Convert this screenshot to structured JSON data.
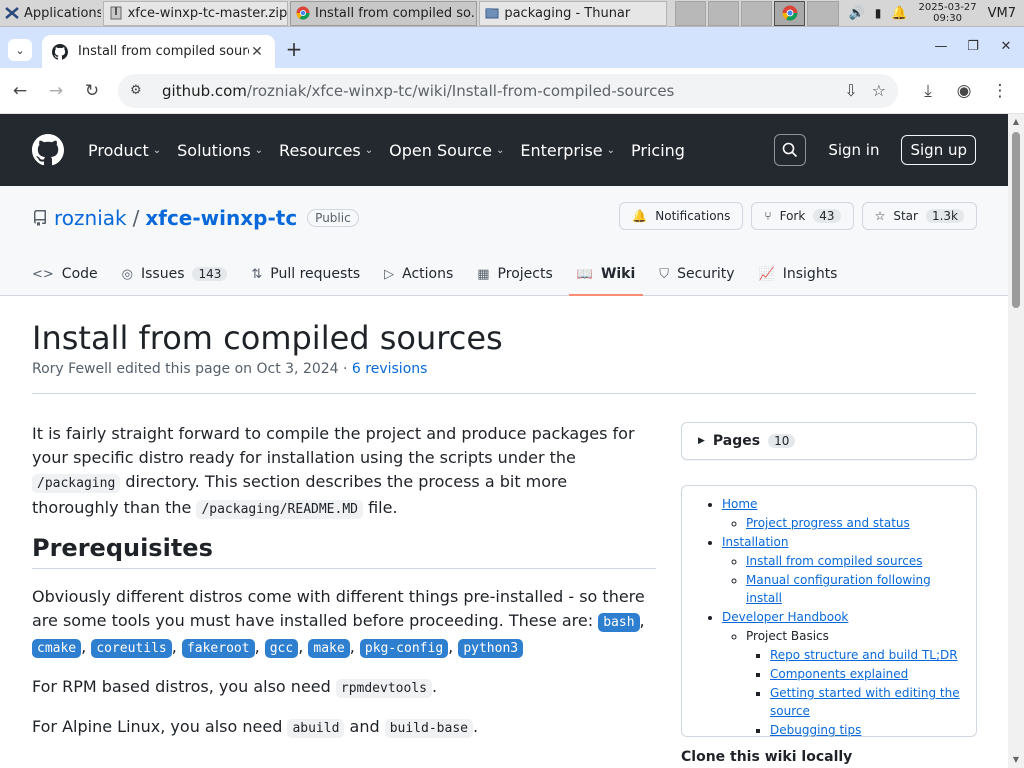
{
  "panel": {
    "applications_label": "Applications",
    "tasks": [
      {
        "label": "xfce-winxp-tc-master.zip ..."
      },
      {
        "label": "Install from compiled so..."
      },
      {
        "label": "packaging - Thunar"
      }
    ],
    "clock_date": "2025-03-27",
    "clock_time": "09:30",
    "vm_label": "VM7"
  },
  "browser": {
    "tab_title": "Install from compiled sourc",
    "url_host": "github.com",
    "url_path": "/rozniak/xfce-winxp-tc/wiki/Install-from-compiled-sources"
  },
  "github_nav": {
    "items": [
      "Product",
      "Solutions",
      "Resources",
      "Open Source",
      "Enterprise",
      "Pricing"
    ],
    "sign_in": "Sign in",
    "sign_up": "Sign up"
  },
  "repo": {
    "owner": "rozniak",
    "separator": "/",
    "name": "xfce-winxp-tc",
    "visibility": "Public",
    "notifications_label": "Notifications",
    "fork_label": "Fork",
    "fork_count": "43",
    "star_label": "Star",
    "star_count": "1.3k",
    "tabs": [
      {
        "label": "Code",
        "icon": "code-icon"
      },
      {
        "label": "Issues",
        "icon": "issue-icon",
        "count": "143"
      },
      {
        "label": "Pull requests",
        "icon": "pull-request-icon"
      },
      {
        "label": "Actions",
        "icon": "play-icon"
      },
      {
        "label": "Projects",
        "icon": "table-icon"
      },
      {
        "label": "Wiki",
        "icon": "book-icon",
        "selected": true
      },
      {
        "label": "Security",
        "icon": "shield-icon"
      },
      {
        "label": "Insights",
        "icon": "graph-icon"
      }
    ]
  },
  "page": {
    "title": "Install from compiled sources",
    "meta_text": "Rory Fewell edited this page on Oct 3, 2024 · ",
    "revisions_link": "6 revisions",
    "intro_1": "It is fairly straight forward to compile the project and produce packages for your specific distro ready for installation using the scripts under the ",
    "intro_code_1": "/packaging",
    "intro_2": " directory. This section describes the process a bit more thoroughly than the ",
    "intro_code_2": "/packaging/README.MD",
    "intro_3": " file.",
    "prereq_heading": "Prerequisites",
    "prereq_text": "Obviously different distros come with different things pre-installed - so there are some tools you must have installed before proceeding. These are: ",
    "prereq_tools": [
      "bash",
      "cmake",
      "coreutils",
      "fakeroot",
      "gcc",
      "make",
      "pkg-config",
      "python3"
    ],
    "rpm_text": "For RPM based distros, you also need ",
    "rpm_code": "rpmdevtools",
    "alpine_text": "For Alpine Linux, you also need ",
    "alpine_code_1": "abuild",
    "alpine_and": " and ",
    "alpine_code_2": "build-base",
    "period": "."
  },
  "sidebar": {
    "pages_label": "Pages",
    "pages_count": "10",
    "toc": {
      "home": "Home",
      "home_children": [
        "Project progress and status"
      ],
      "installation": "Installation",
      "installation_children": [
        "Install from compiled sources",
        "Manual configuration following install"
      ],
      "dev": "Developer Handbook",
      "project_basics": "Project Basics",
      "project_basics_children": [
        "Repo structure and build TL;DR",
        "Components explained",
        "Getting started with editing the source",
        "Debugging tips"
      ]
    },
    "share_label": "Clone this wiki locally"
  }
}
